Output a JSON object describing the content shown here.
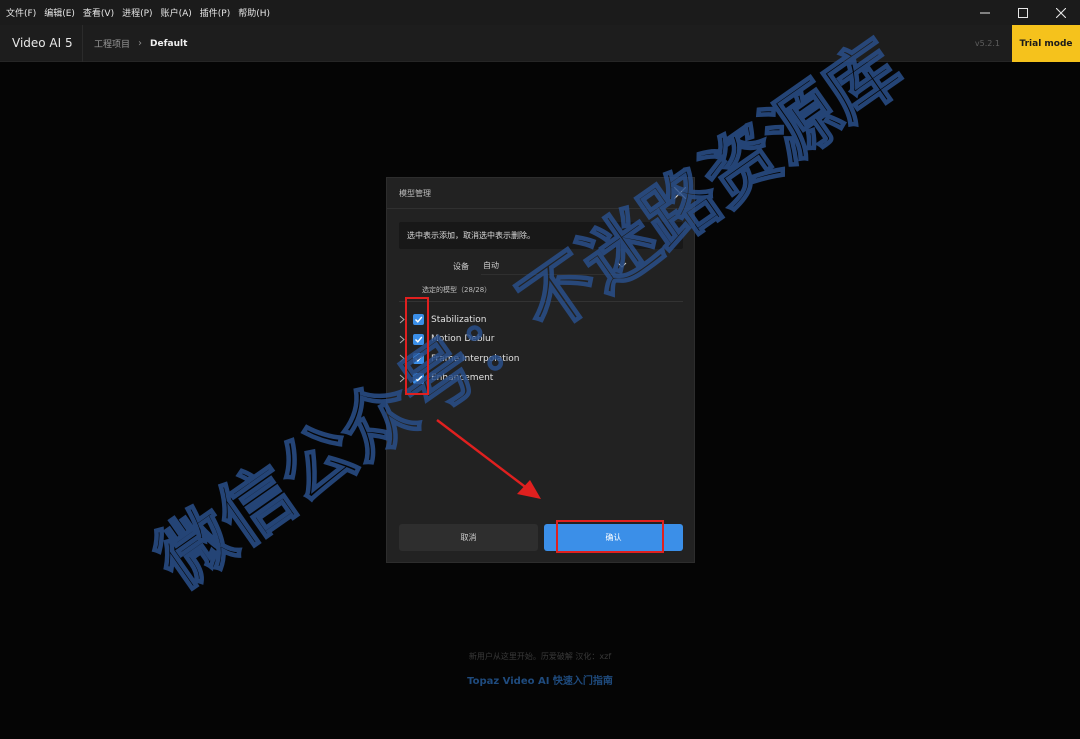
{
  "menubar": {
    "items": [
      "文件(F)",
      "编辑(E)",
      "查看(V)",
      "进程(P)",
      "账户(A)",
      "插件(P)",
      "帮助(H)"
    ]
  },
  "header": {
    "app_name": "Video AI  5",
    "breadcrumb_root": "工程项目",
    "breadcrumb_current": "Default",
    "version": "v5.2.1",
    "trial_label": "Trial mode"
  },
  "dialog": {
    "title": "模型管理",
    "info": "选中表示添加，取消选中表示删除。",
    "device_label": "设备",
    "device_value": "自动",
    "selected_count": "选定的模型（28/28）",
    "models": [
      {
        "label": "Stabilization",
        "checked": true
      },
      {
        "label": "Motion Deblur",
        "checked": true
      },
      {
        "label": "Frame Interpolation",
        "checked": true
      },
      {
        "label": "Enhancement",
        "checked": true
      }
    ],
    "cancel_label": "取消",
    "confirm_label": "确认"
  },
  "footer": {
    "hint": "新用户从这里开始。历爱破解 汉化：xzf",
    "guide": "Topaz Video AI 快速入门指南"
  },
  "watermark": {
    "text": "微信公众号：不迷路资源库"
  },
  "colors": {
    "accent": "#3b8fe8",
    "trial": "#f5c21c",
    "annotation": "#e0201f",
    "watermark": "#1e3c70"
  }
}
